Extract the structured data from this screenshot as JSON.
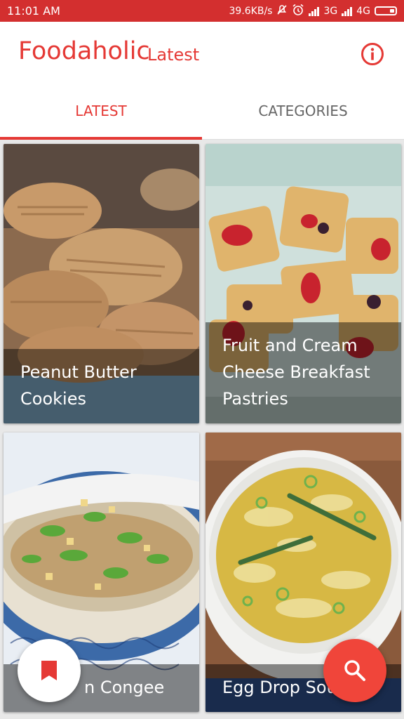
{
  "status_bar": {
    "time": "11:01 AM",
    "net_speed": "39.6KB/s",
    "network_3g": "3G",
    "network_4g": "4G"
  },
  "app_bar": {
    "title": "Foodaholic",
    "subtitle": "Latest",
    "info_icon": "info-icon"
  },
  "tabs": [
    {
      "label": "LATEST",
      "active": true
    },
    {
      "label": "CATEGORIES",
      "active": false
    }
  ],
  "recipes": [
    {
      "title": "Peanut Butter Cookies"
    },
    {
      "title": "Fruit and Cream Cheese Breakfast Pastries"
    },
    {
      "title": "n Congee"
    },
    {
      "title": "Egg Drop Sou"
    }
  ],
  "fabs": {
    "bookmark_icon": "bookmark-icon",
    "search_icon": "search-icon"
  },
  "colors": {
    "primary": "#e53935",
    "status_bar": "#d32f2f",
    "fab_search": "#f0453a"
  }
}
